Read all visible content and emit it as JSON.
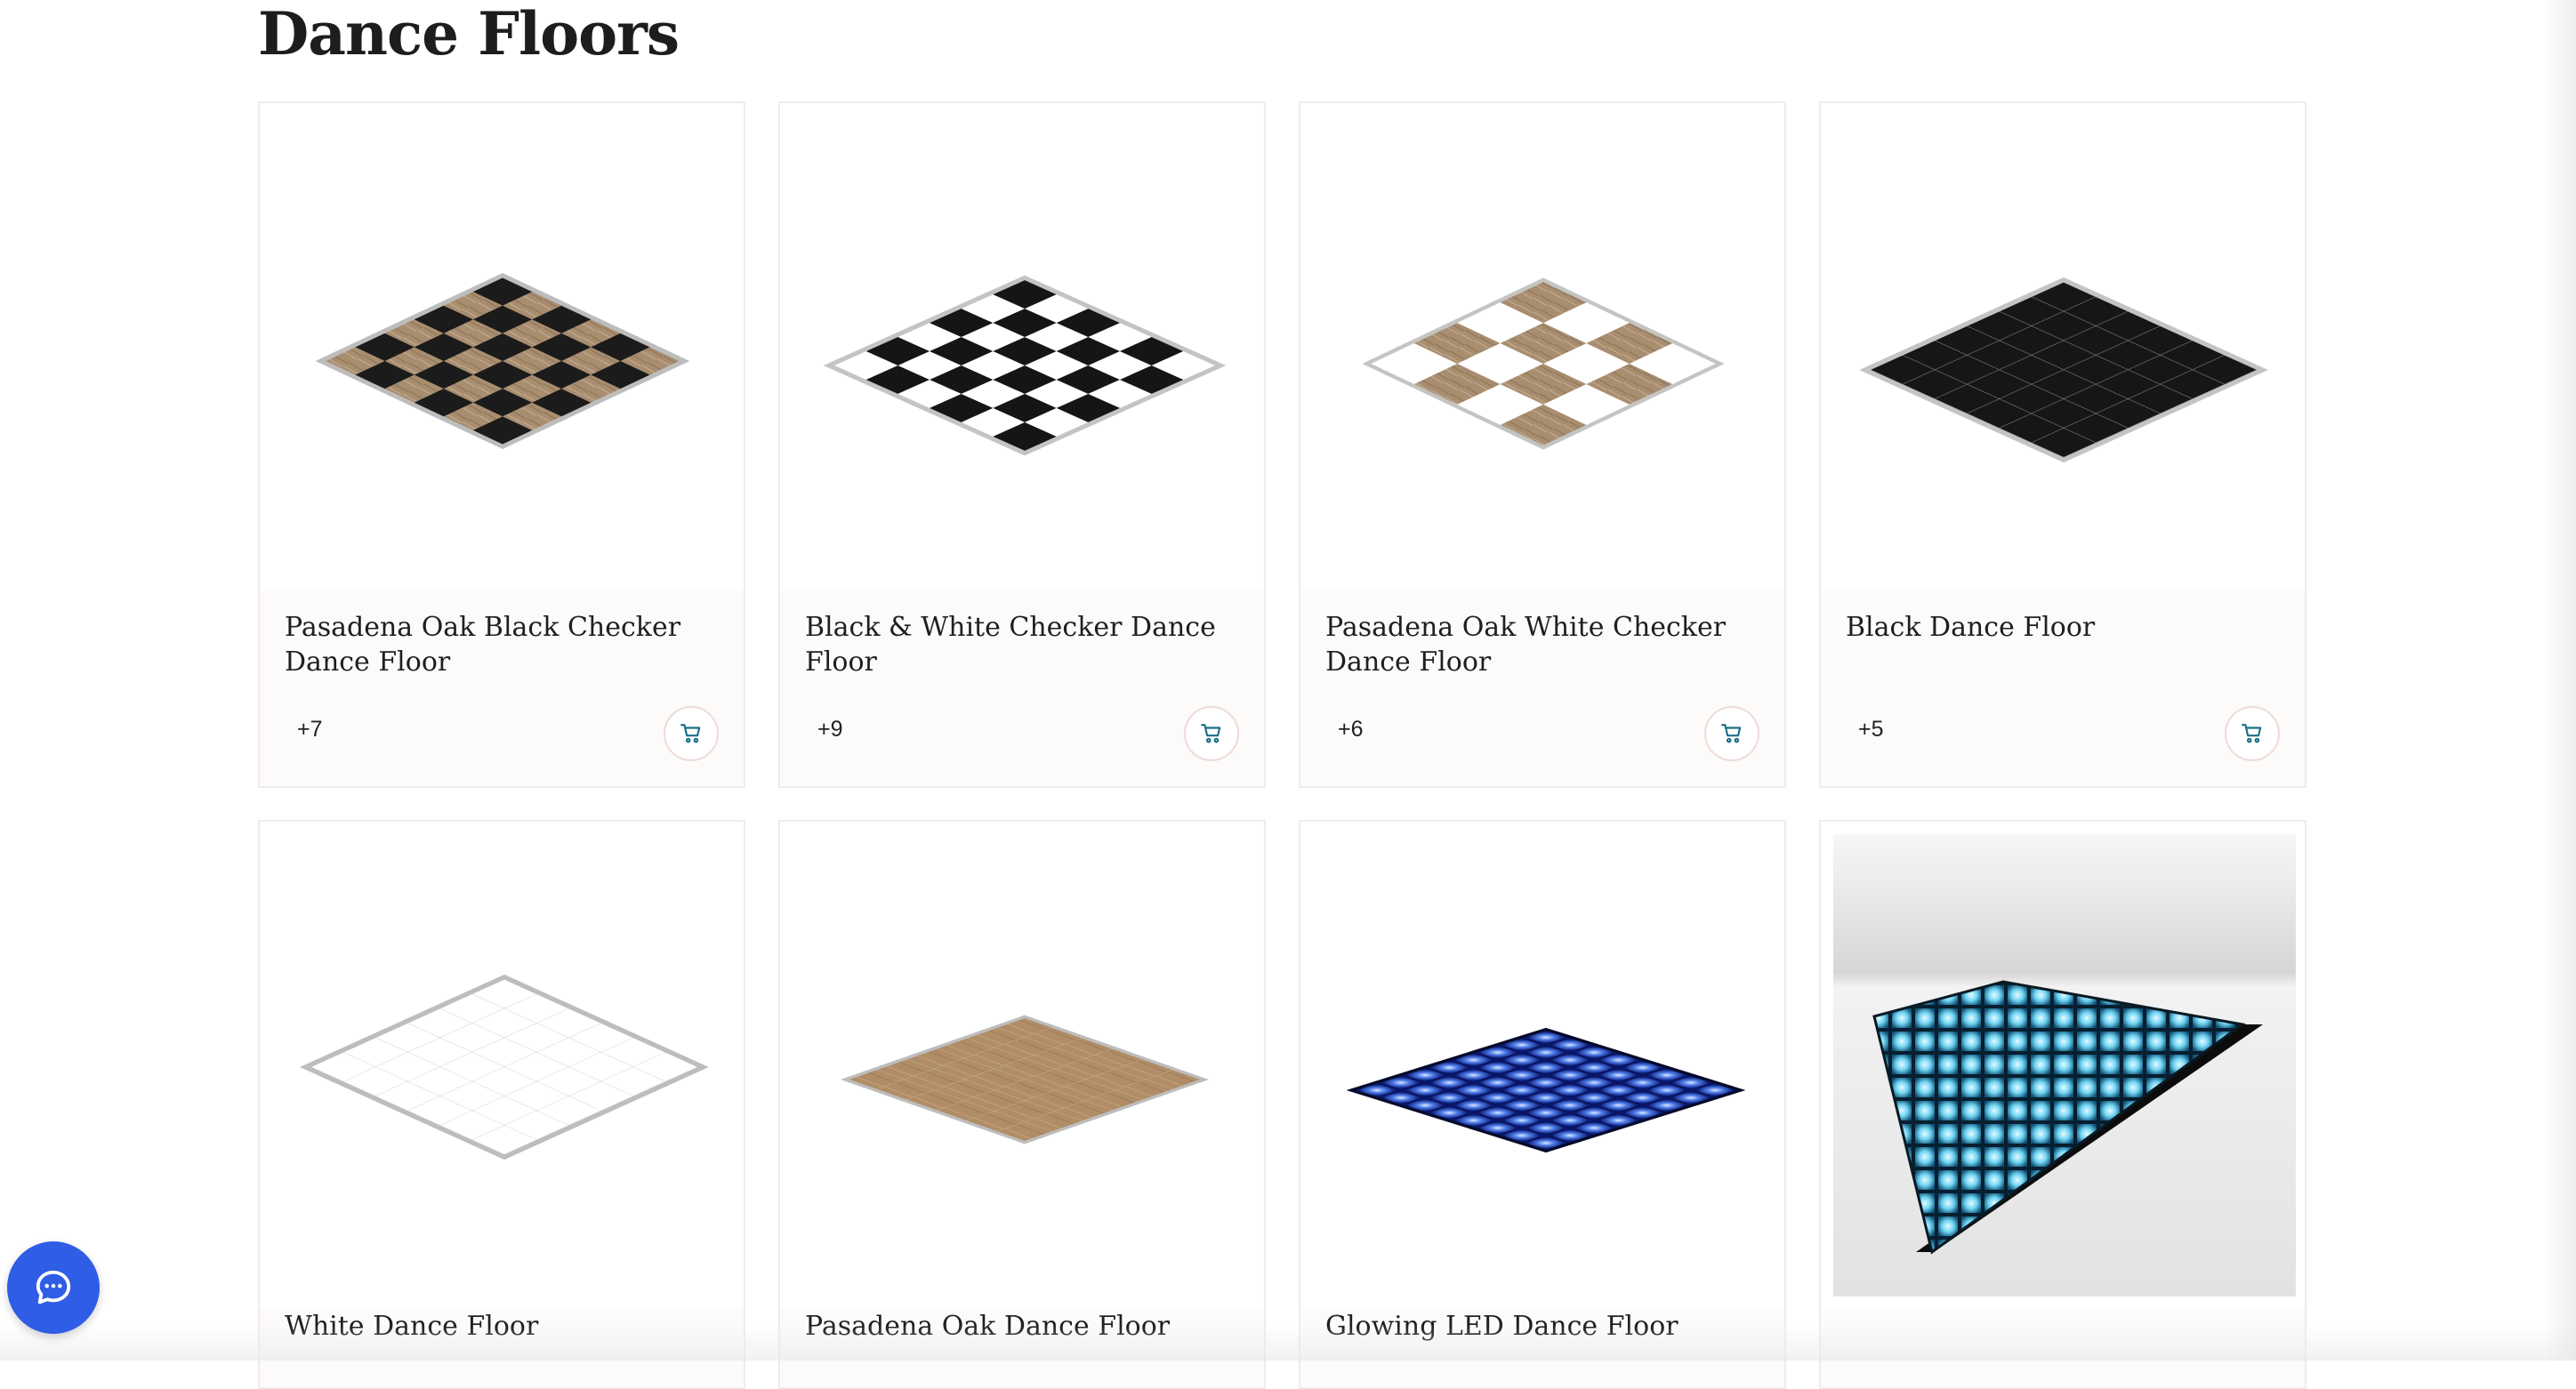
{
  "page": {
    "title": "Dance Floors"
  },
  "products": [
    {
      "name": "Pasadena Oak Black Checker Dance Floor",
      "variants": "+7",
      "image": "pasadena-oak-black-checker-floor"
    },
    {
      "name": "Black & White Checker Dance Floor",
      "variants": "+9",
      "image": "black-white-checker-floor"
    },
    {
      "name": "Pasadena Oak White Checker Dance Floor",
      "variants": "+6",
      "image": "pasadena-oak-white-checker-floor"
    },
    {
      "name": "Black Dance Floor",
      "variants": "+5",
      "image": "black-floor"
    },
    {
      "name": "White Dance Floor",
      "image": "white-floor"
    },
    {
      "name": "Pasadena Oak Dance Floor",
      "image": "pasadena-oak-floor"
    },
    {
      "name": "Glowing LED Dance Floor",
      "image": "led-floor"
    },
    {
      "name": "",
      "image": "led-floor-studio"
    }
  ],
  "icons": {
    "cart": "cart-icon",
    "chat": "chat-icon"
  },
  "colors": {
    "accent": "#2f5de6",
    "cart_icon": "#1b6f8a",
    "card_border": "#f1ecea"
  }
}
